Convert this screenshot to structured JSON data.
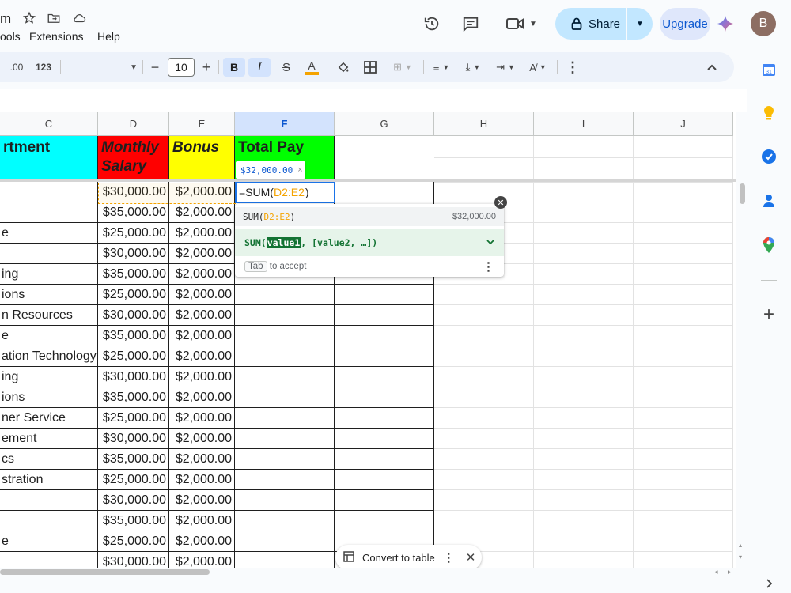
{
  "header": {
    "title_fragment": "m",
    "menus": [
      "ools",
      "Extensions",
      "Help"
    ],
    "share_label": "Share",
    "upgrade_label": "Upgrade",
    "avatar_letter": "B"
  },
  "toolbar": {
    "decimal_label": ".00",
    "number_format_label": "123",
    "font_size": "10",
    "bold_label": "B",
    "italic_label": "I",
    "text_color_label": "A",
    "text_color": "#f4a300"
  },
  "grid": {
    "columns": [
      "C",
      "D",
      "E",
      "F",
      "G",
      "H",
      "I",
      "J"
    ],
    "selected_column": "F",
    "header_row": {
      "department": "rtment",
      "monthly_salary_line1": "Monthly",
      "monthly_salary_line2": "Salary",
      "bonus": "Bonus",
      "total_pay": "Total Pay"
    },
    "rows": [
      {
        "dept": "",
        "salary": "$30,000.00",
        "bonus": "$2,000.00"
      },
      {
        "dept": "",
        "salary": "$35,000.00",
        "bonus": "$2,000.00"
      },
      {
        "dept": "e",
        "salary": "$25,000.00",
        "bonus": "$2,000.00"
      },
      {
        "dept": "",
        "salary": "$30,000.00",
        "bonus": "$2,000.00"
      },
      {
        "dept": "ing",
        "salary": "$35,000.00",
        "bonus": "$2,000.00"
      },
      {
        "dept": "ions",
        "salary": "$25,000.00",
        "bonus": "$2,000.00"
      },
      {
        "dept": "n Resources",
        "salary": "$30,000.00",
        "bonus": "$2,000.00"
      },
      {
        "dept": "e",
        "salary": "$35,000.00",
        "bonus": "$2,000.00"
      },
      {
        "dept": "ation Technology",
        "salary": "$25,000.00",
        "bonus": "$2,000.00"
      },
      {
        "dept": "ing",
        "salary": "$30,000.00",
        "bonus": "$2,000.00"
      },
      {
        "dept": "ions",
        "salary": "$35,000.00",
        "bonus": "$2,000.00"
      },
      {
        "dept": "ner Service",
        "salary": "$25,000.00",
        "bonus": "$2,000.00"
      },
      {
        "dept": "ement",
        "salary": "$30,000.00",
        "bonus": "$2,000.00"
      },
      {
        "dept": "cs",
        "salary": "$35,000.00",
        "bonus": "$2,000.00"
      },
      {
        "dept": "stration",
        "salary": "$25,000.00",
        "bonus": "$2,000.00"
      },
      {
        "dept": "",
        "salary": "$30,000.00",
        "bonus": "$2,000.00"
      },
      {
        "dept": "",
        "salary": "$35,000.00",
        "bonus": "$2,000.00"
      },
      {
        "dept": "e",
        "salary": "$25,000.00",
        "bonus": "$2,000.00"
      },
      {
        "dept": "",
        "salary": "$30,000.00",
        "bonus": "$2,000.00"
      }
    ],
    "editing_cell": {
      "formula_prefix": "=SUM(",
      "formula_range": "D2:E2",
      "formula_suffix": ")",
      "preview_tooltip": "$32,000.00"
    }
  },
  "autocomplete": {
    "suggestion_fn": "SUM(",
    "suggestion_range": "D2:E2",
    "suggestion_close": ")",
    "suggestion_result": "$32,000.00",
    "signature_fn": "SUM(",
    "signature_param": "value1",
    "signature_rest": ", [value2, …])",
    "tab_key": "Tab",
    "tab_hint": "to accept"
  },
  "convert_to_table": {
    "label": "Convert to table"
  },
  "colors": {
    "cyan": "#00ffff",
    "red": "#ff0000",
    "yellow": "#ffff00",
    "green": "#00ff00",
    "accent": "#0b57d0",
    "range_orange": "#f4a300"
  }
}
